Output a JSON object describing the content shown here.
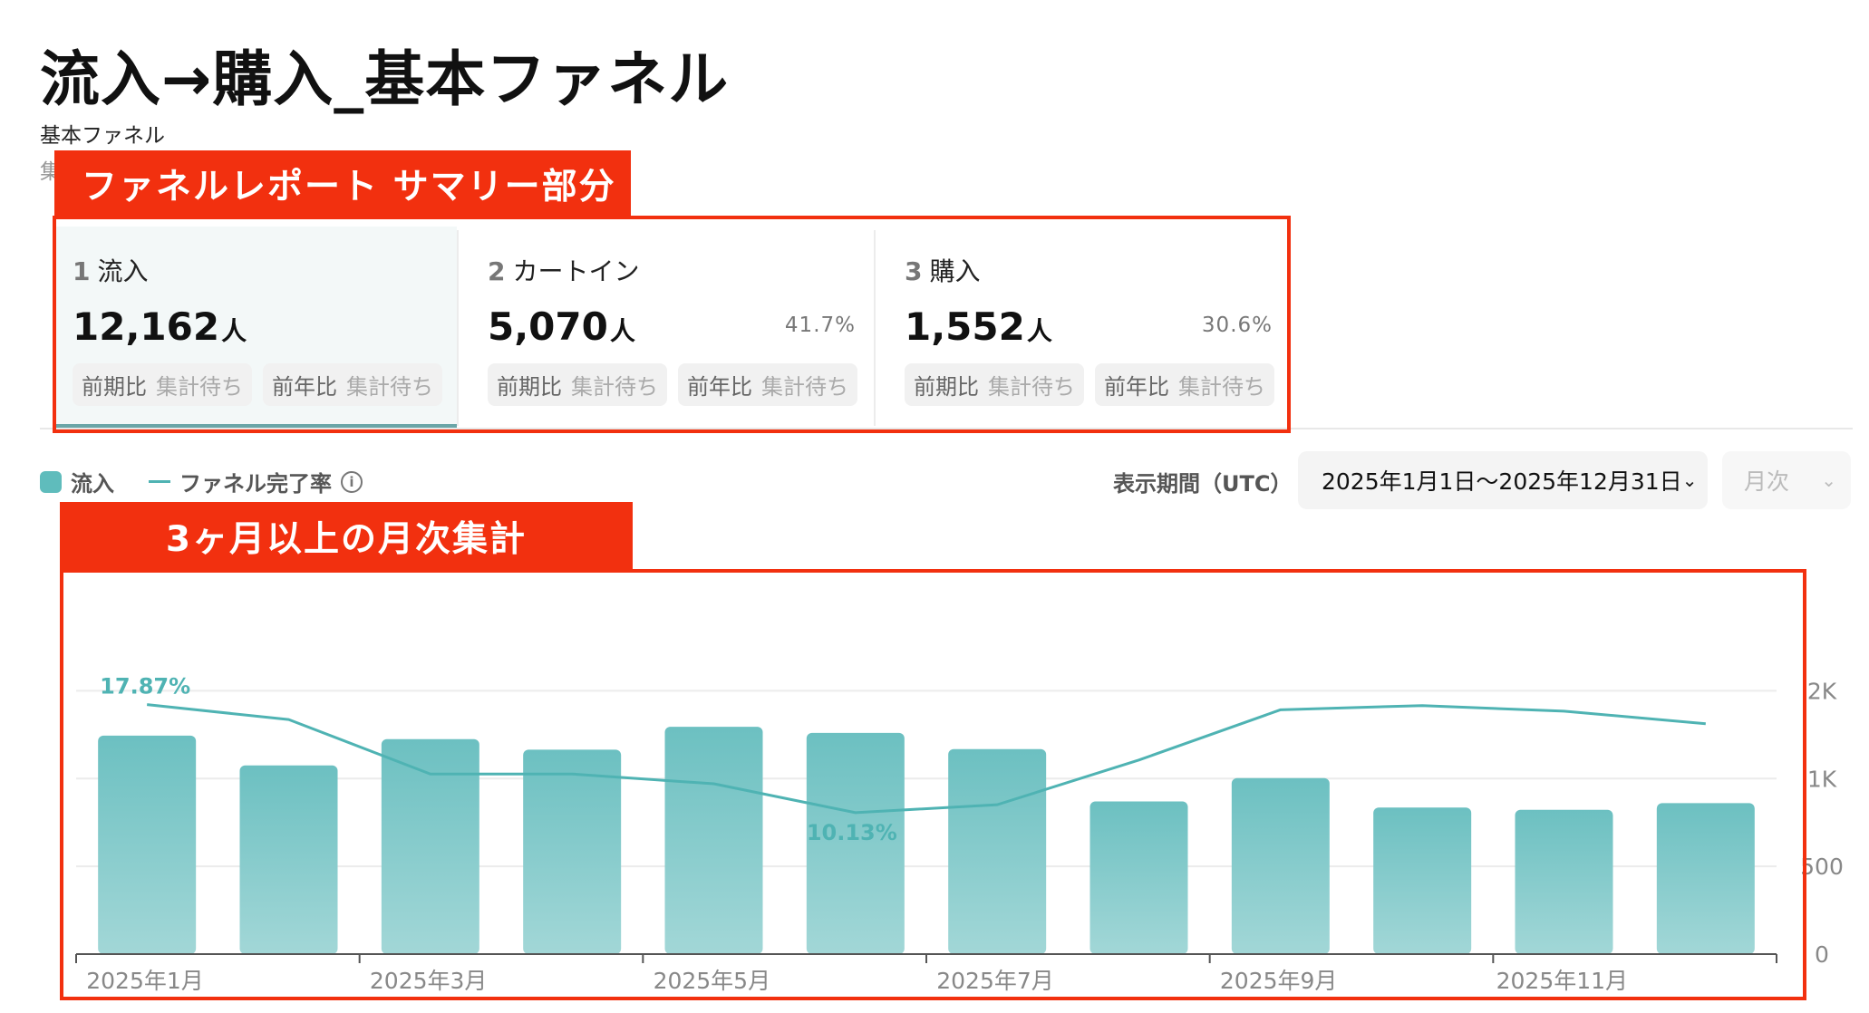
{
  "header": {
    "title": "流入→購入_基本ファネル",
    "subtitle": "基本ファネル",
    "subtitle2_partial": "集"
  },
  "annotations": {
    "summary_callout": "ファネルレポート サマリー部分",
    "chart_callout": "3ヶ月以上の月次集計",
    "highlight_color": "#f2300f"
  },
  "funnel_steps": [
    {
      "index": "1",
      "label": "流入",
      "value": "12,162",
      "unit": "人",
      "rate": "",
      "chips": [
        {
          "key": "前期比",
          "value": "集計待ち"
        },
        {
          "key": "前年比",
          "value": "集計待ち"
        }
      ]
    },
    {
      "index": "2",
      "label": "カートイン",
      "value": "5,070",
      "unit": "人",
      "rate": "41.7%",
      "chips": [
        {
          "key": "前期比",
          "value": "集計待ち"
        },
        {
          "key": "前年比",
          "value": "集計待ち"
        }
      ]
    },
    {
      "index": "3",
      "label": "購入",
      "value": "1,552",
      "unit": "人",
      "rate": "30.6%",
      "chips": [
        {
          "key": "前期比",
          "value": "集計待ち"
        },
        {
          "key": "前年比",
          "value": "集計待ち"
        }
      ]
    }
  ],
  "legend": {
    "bar_label": "流入",
    "line_label": "ファネル完了率",
    "info_icon": "info-icon"
  },
  "controls": {
    "period_label": "表示期間（UTC）",
    "period_value": "2025年1月1日〜2025年12月31日",
    "granularity": "月次"
  },
  "colors": {
    "bar_top": "#6cc0c1",
    "bar_bottom": "#a2d7d7",
    "line": "#4fb3b3",
    "accent": "#5fbcbc"
  },
  "chart_data": {
    "type": "bar",
    "categories": [
      "2025年1月",
      "2025年2月",
      "2025年3月",
      "2025年4月",
      "2025年5月",
      "2025年6月",
      "2025年7月",
      "2025年8月",
      "2025年9月",
      "2025年10月",
      "2025年11月",
      "2025年12月"
    ],
    "x_tick_labels": [
      "2025年1月",
      "2025年3月",
      "2025年5月",
      "2025年7月",
      "2025年9月",
      "2025年11月"
    ],
    "y_tick_labels": [
      "0",
      "500",
      "1K",
      "2K"
    ],
    "series": [
      {
        "name": "流入",
        "type": "bar",
        "axis": "right",
        "values": [
          1245,
          1075,
          1225,
          1165,
          1295,
          1260,
          1168,
          870,
          1003,
          835,
          822,
          860
        ]
      },
      {
        "name": "ファネル完了率",
        "type": "line",
        "unit": "%",
        "values": [
          17.87,
          16.8,
          12.9,
          12.9,
          12.2,
          10.13,
          10.7,
          13.9,
          17.5,
          17.8,
          17.4,
          16.5
        ]
      }
    ],
    "line_labels": [
      {
        "index": 0,
        "text": "17.87%"
      },
      {
        "index": 5,
        "text": "10.13%"
      }
    ],
    "y_axis": {
      "ticks": [
        0,
        500,
        1000,
        1500
      ],
      "ylim": [
        0,
        1750
      ]
    },
    "line_axis": {
      "ylim": [
        0,
        22
      ]
    },
    "grid": true,
    "legend_position": "top-left"
  }
}
